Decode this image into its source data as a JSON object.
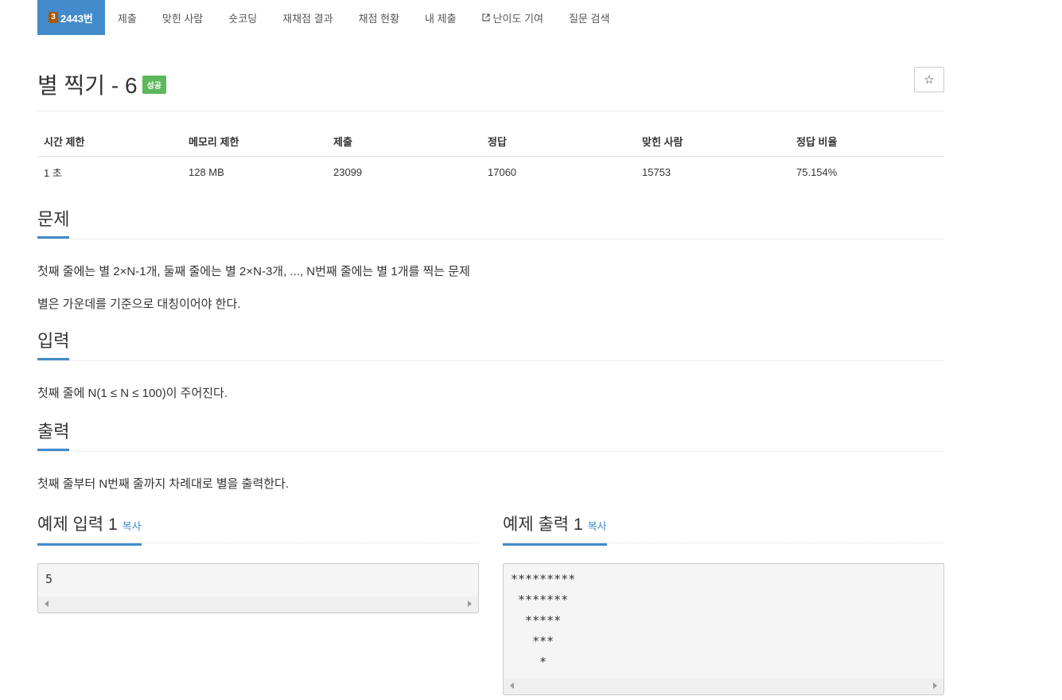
{
  "nav": {
    "tier": "3",
    "problem_no": "2443번",
    "items": [
      "제출",
      "맞힌 사람",
      "숏코딩",
      "재채점 결과",
      "채점 현황",
      "내 제출",
      "난이도 기여",
      "질문 검색"
    ]
  },
  "header": {
    "title": "별 찍기 - 6",
    "status_badge": "성공",
    "star_icon": "☆"
  },
  "info": {
    "headers": [
      "시간 제한",
      "메모리 제한",
      "제출",
      "정답",
      "맞힌 사람",
      "정답 비율"
    ],
    "values": [
      "1 초",
      "128 MB",
      "23099",
      "17060",
      "15753",
      "75.154%"
    ]
  },
  "problem": {
    "title": "문제",
    "lines": [
      "첫째 줄에는 별 2×N-1개, 둘째 줄에는 별 2×N-3개, ..., N번째 줄에는 별 1개를 찍는 문제",
      "별은 가운데를 기준으로 대칭이어야 한다."
    ]
  },
  "input": {
    "title": "입력",
    "text": "첫째 줄에 N(1 ≤ N ≤ 100)이 주어진다."
  },
  "output": {
    "title": "출력",
    "text": "첫째 줄부터 N번째 줄까지 차례대로 별을 출력한다."
  },
  "sample_input": {
    "title": "예제 입력 1",
    "copy_label": "복사",
    "content": "5"
  },
  "sample_output": {
    "title": "예제 출력 1",
    "copy_label": "복사",
    "content": "*********\n *******\n  *****\n   ***\n    *"
  },
  "colors": {
    "accent": "#428bca",
    "success": "#5cb85c",
    "tier_bronze": "#ad5600"
  }
}
